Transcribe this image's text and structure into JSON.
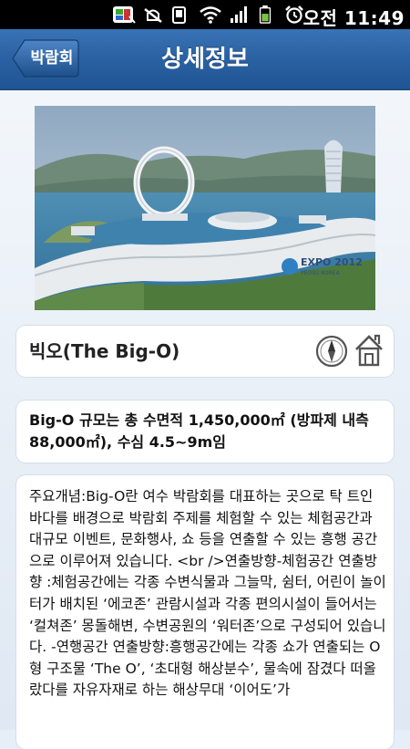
{
  "status_bar": {
    "time": "오전 11:49",
    "icons": [
      "app-notification-icon",
      "dnd-icon",
      "mute-icon",
      "vibrate-icon",
      "wifi-icon",
      "signal-icon",
      "battery-icon",
      "alarm-icon"
    ]
  },
  "header": {
    "back_label": "박람회",
    "title": "상세정보"
  },
  "detail": {
    "name": "빅오(The Big-O)",
    "summary": "Big-O 규모는 총 수면적 1,450,000㎡ (방파제 내측 88,000㎡), 수심 4.5~9m임",
    "description": "주요개념:Big-O란 여수 박람회를 대표하는 곳으로 탁 트인 바다를 배경으로 박람회 주제를 체험할 수 있는 체험공간과 대규모 이벤트, 문화행사, 쇼 등을 연출할 수 있는 흥행 공간으로 이루어져 있습니다. <br />연출방향-체험공간 연출방향 :체험공간에는 각종 수변식물과 그늘막, 쉼터, 어린이 놀이터가 배치된 ‘에코존’ 관람시설과 각종 편의시설이 들어서는 ‘컬쳐존’ 몽돌해변, 수변공원의 ‘워터존’으로 구성되어 있습니다. -연행공간 연출방향:흥행공간에는 각종 쇼가 연출되는 O형 구조물 ‘The O’, ‘초대형 해상분수’, 물속에 잠겼다 떠올랐다를 자유자재로 하는 해상무대 ‘이어도’가",
    "image_caption": "EXPO 2012 YEOSU KOREA"
  },
  "colors": {
    "title_bar": "#2b62a3",
    "background": "#e6eef7",
    "card": "#ffffff"
  }
}
